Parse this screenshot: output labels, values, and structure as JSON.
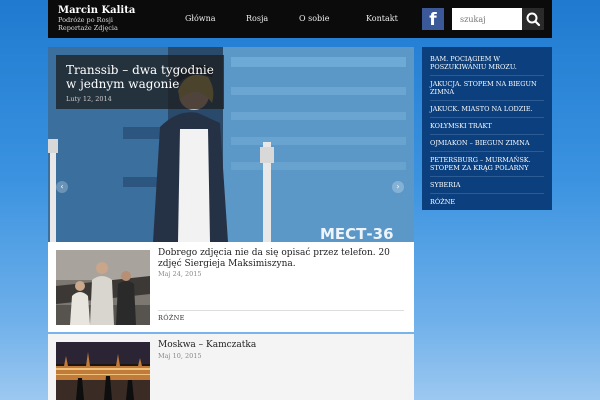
{
  "header": {
    "site_title": "Marcin Kalita",
    "tagline_1": "Podróże po Rosji",
    "tagline_2": "Reportaże Zdjęcia",
    "nav": [
      "Główna",
      "Rosja",
      "O sobie",
      "Kontakt"
    ],
    "social": "f",
    "search_placeholder": "szukaj",
    "icons": {
      "facebook": "facebook-icon",
      "search": "search-icon"
    }
  },
  "slider": {
    "title": "Transsib – dwa tygodnie w jednym wagonie",
    "date": "Luty 12, 2014",
    "train_sign": "МЕСТ-36",
    "prev": "‹",
    "next": "›"
  },
  "posts": [
    {
      "title": "Dobrego zdjęcia nie da się opisać przez telefon. 20 zdjęć Siergieja Maksimiszyna.",
      "date": "Maj 24, 2015",
      "category": "RÓŻNE"
    },
    {
      "title": "Moskwa – Kamczatka",
      "date": "Maj 10, 2015"
    }
  ],
  "sidebar": {
    "links": [
      "BAM. POCIĄGIEM W POSZUKIWANIU MROZU.",
      "JAKUCJA. STOPEM NA BIEGUN ZIMNA",
      "JAKUCK. MIASTO NA LODZIE.",
      "KOŁYMSKI TRAKT",
      "OJMIAKON – BIEGUN ZIMNA",
      "PETERSBURG – MURMAŃSK. STOPEM ZA KRĄG POLARNY",
      "SYBERIA",
      "RÓŻNE"
    ]
  },
  "colors": {
    "accent": "#0b3f7d",
    "topbar": "#0b0b0b",
    "background": "#3b93e0",
    "facebook": "#3b5998"
  }
}
